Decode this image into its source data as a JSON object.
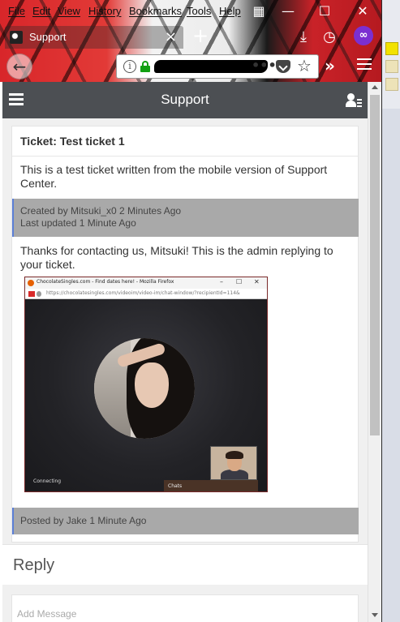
{
  "menu": [
    "File",
    "Edit",
    "View",
    "History",
    "Bookmarks",
    "Tools",
    "Help"
  ],
  "window_controls": {
    "minimize": "—",
    "maximize": "☐",
    "close": "✕"
  },
  "tab": {
    "title": "Support",
    "close": "×",
    "new_tab": "+"
  },
  "toolbar_icons": [
    "download-icon",
    "history-clock-icon",
    "private-mask-icon"
  ],
  "urlbar": {
    "info": "i",
    "more": "•••",
    "bookmark": "☆"
  },
  "overflow": "»",
  "app": {
    "title": "Support"
  },
  "ticket": {
    "title": "Ticket: Test ticket 1",
    "body": "This is a test ticket written from the mobile version of Support Center.",
    "created": "Created by Mitsuki_x0 2 Minutes Ago",
    "updated": "Last updated 1 Minute Ago"
  },
  "reply": {
    "body": "Thanks for contacting us, Mitsuki! This is the admin replying to your ticket.",
    "screenshot": {
      "window_title": "ChocolateSingles.com - Find dates here! - Mozilla Firefox",
      "url": "https://chocolatesingles.com/videoim/video-im/chat-window/?recipientId=114&",
      "status": "Connecting",
      "chats_label": "Chats"
    },
    "posted": "Posted by Jake 1 Minute Ago"
  },
  "reply_section": {
    "heading": "Reply",
    "placeholder": "Add Message"
  },
  "colors": {
    "appbar": "#4c4f53",
    "meta_bg": "#a9a9a9",
    "meta_accent": "#5b7fd6",
    "lock": "#12a012",
    "private": "#7b2fd1"
  }
}
